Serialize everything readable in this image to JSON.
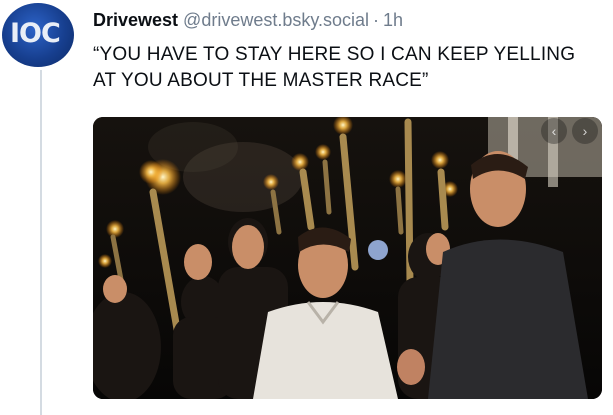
{
  "post": {
    "author": {
      "display_name": "Drivewest",
      "handle": "@drivewest.bsky.social",
      "avatar_text": "IOC"
    },
    "separator": "·",
    "time": "1h",
    "text": "“YOU HAVE TO STAY HERE SO I CAN KEEP YELLING AT YOU ABOUT THE MASTER RACE”",
    "media": {
      "type": "photo",
      "description_icon": "photo",
      "nav": {
        "prev": "‹",
        "next": "›"
      }
    }
  },
  "colors": {
    "text": "#0b0f14",
    "muted": "#6f7c8c",
    "avatar_bg": "#1e4da3",
    "thread_line": "#d4dbe2"
  }
}
